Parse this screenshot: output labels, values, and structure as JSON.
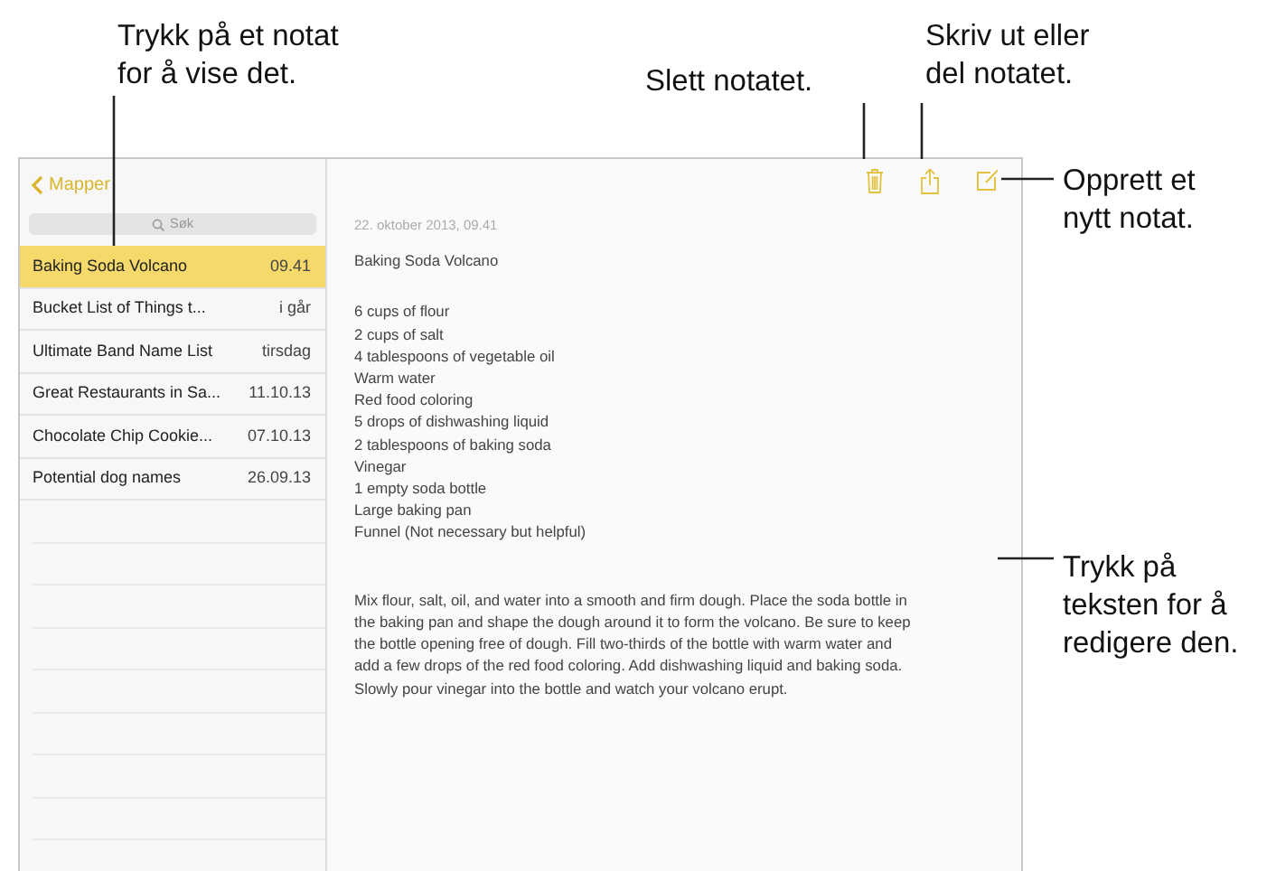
{
  "callouts": [
    {
      "kind": "tap-note",
      "text": "Trykk på et notat\nfor å vise det."
    },
    {
      "kind": "delete",
      "text": "Slett notatet."
    },
    {
      "kind": "share",
      "text": "Skriv ut eller\ndel notatet."
    },
    {
      "kind": "compose",
      "text": "Opprett et\nnytt notat."
    },
    {
      "kind": "edit",
      "text": "Trykk på\nteksten for å\nredigere den."
    }
  ],
  "sidebar": {
    "back": "Mapper",
    "search": {
      "placeholder": "Søk"
    },
    "notes": [
      {
        "title": "Baking Soda Volcano",
        "date": "09.41",
        "selected": true
      },
      {
        "title": "Bucket List of Things t...",
        "date": "i går",
        "selected": false
      },
      {
        "title": "Ultimate Band Name List",
        "date": "tirsdag",
        "selected": false
      },
      {
        "title": "Great Restaurants in Sa...",
        "date": "11.10.13",
        "selected": false
      },
      {
        "title": "Chocolate Chip Cookie...",
        "date": "07.10.13",
        "selected": false
      },
      {
        "title": "Potential dog names",
        "date": "26.09.13",
        "selected": false
      }
    ]
  },
  "note": {
    "date": "22. oktober 2013, 09.41",
    "title": "Baking Soda Volcano",
    "ingredients": [
      "6 cups of flour",
      "2 cups of salt",
      "4 tablespoons of vegetable oil",
      "Warm water",
      "Red food coloring",
      "5 drops of dishwashing liquid",
      "2 tablespoons of baking soda",
      "Vinegar",
      "1 empty soda bottle",
      "Large baking pan",
      "Funnel (Not necessary but helpful)"
    ],
    "body_lines": [
      "Mix flour, salt, oil, and water into a smooth and firm dough.  Place the soda bottle in",
      "the baking pan and shape the dough around it to form the volcano.  Be sure to keep",
      "the bottle opening free of dough.  Fill two-thirds of the bottle with warm water and",
      "add a few drops of the red food coloring. Add dishwashing liquid and baking soda.",
      "Slowly pour vinegar into the bottle and watch your volcano erupt."
    ]
  }
}
